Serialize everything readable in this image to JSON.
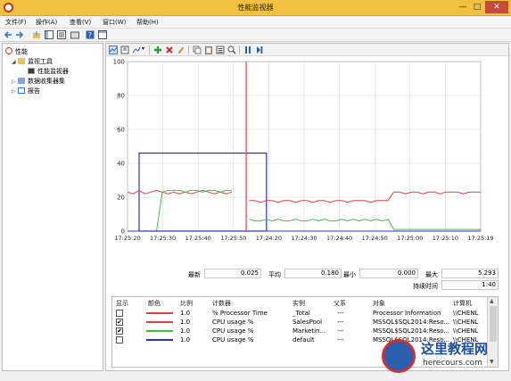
{
  "window": {
    "title": "性能监视器",
    "minimize": "—",
    "maximize": "□",
    "close": "✕"
  },
  "menu": [
    "文件(F)",
    "操作(A)",
    "查看(V)",
    "窗口(W)",
    "帮助(H)"
  ],
  "tree": [
    {
      "label": "性能",
      "icon": "performance-icon"
    },
    {
      "label": "监视工具",
      "icon": "folder-icon"
    },
    {
      "label": "性能监视器",
      "icon": "monitor-icon"
    },
    {
      "label": "数据收集器集",
      "icon": "data-collector-icon"
    },
    {
      "label": "报告",
      "icon": "report-icon"
    }
  ],
  "stats": {
    "last_label": "最新",
    "last_value": "0.025",
    "avg_label": "平均",
    "avg_value": "0.180",
    "min_label": "最小",
    "min_value": "0.000",
    "max_label": "最大",
    "max_value": "5.293",
    "duration_label": "持续时间",
    "duration_value": "1:40"
  },
  "table": {
    "headers": [
      "显示",
      "颜色",
      "比例",
      "计数器",
      "实例",
      "父系",
      "对象",
      "计算机"
    ],
    "rows": [
      {
        "checked": false,
        "color": "#e04040",
        "scale": "1.0",
        "counter": "% Processor Time",
        "instance": "_Total",
        "parent": "---",
        "object": "Processor Information",
        "computer": "\\\\CHENL"
      },
      {
        "checked": true,
        "color": "#e04040",
        "scale": "1.0",
        "counter": "CPU usage %",
        "instance": "SalesPool",
        "parent": "---",
        "object": "MSSQL$SQL2014:Reso...",
        "computer": "\\\\CHENL"
      },
      {
        "checked": true,
        "color": "#40c040",
        "scale": "1.0",
        "counter": "CPU usage %",
        "instance": "Marketin...",
        "parent": "---",
        "object": "MSSQL$SQL2014:Reso...",
        "computer": "\\\\CHENL"
      },
      {
        "checked": false,
        "color": "#3030c0",
        "scale": "1.0",
        "counter": "CPU usage %",
        "instance": "default",
        "parent": "---",
        "object": "MSSQL$SQL2014:Reso...",
        "computer": "\\\\CHENL"
      }
    ]
  },
  "watermark": {
    "title": "这里教程网",
    "url": "herecours.com"
  },
  "chart_data": {
    "type": "line",
    "ylim": [
      0,
      100
    ],
    "yticks": [
      0,
      20,
      40,
      60,
      80,
      100
    ],
    "xticks": [
      "17:25:20",
      "17:25:30",
      "17:25:40",
      "17:25:50",
      "17:24:20",
      "17:24:30",
      "17:24:40",
      "17:24:50",
      "17:25:00",
      "17:25:10",
      "17:25:19"
    ],
    "grid": true,
    "series": [
      {
        "color": "#e04040",
        "values": [
          23,
          22,
          24,
          22,
          23,
          24,
          23,
          22,
          23,
          22,
          23,
          22,
          23,
          24,
          23,
          22,
          23,
          22,
          23,
          null,
          null,
          18,
          18,
          17,
          18,
          18,
          17,
          18,
          18,
          17,
          18,
          18,
          17,
          18,
          18,
          17,
          18,
          18,
          17,
          18,
          18,
          18,
          17,
          18,
          18,
          18,
          23,
          23,
          22,
          23,
          23,
          22,
          23,
          23,
          22,
          23,
          23,
          23,
          22,
          23,
          23,
          23
        ]
      },
      {
        "color": "#40c040",
        "values": [
          0,
          0,
          0,
          0,
          0,
          0,
          23,
          24,
          24,
          24,
          23,
          24,
          24,
          23,
          24,
          24,
          23,
          24,
          24,
          null,
          null,
          7,
          6,
          6,
          7,
          6,
          7,
          6,
          6,
          7,
          6,
          6,
          7,
          6,
          7,
          6,
          6,
          7,
          6,
          7,
          6,
          7,
          6,
          7,
          6,
          7,
          1,
          1,
          1,
          1,
          1,
          1,
          1,
          1,
          1,
          1,
          1,
          1,
          1,
          1,
          1,
          1
        ]
      },
      {
        "color": "#3030c0",
        "values": [
          0,
          0,
          0,
          0,
          0,
          0,
          0,
          0,
          0,
          0,
          0,
          0,
          0,
          0,
          0,
          0,
          0,
          0,
          0,
          null,
          null,
          0,
          0,
          0,
          0,
          0,
          0,
          0,
          0,
          0,
          0,
          0,
          0,
          0,
          0,
          0,
          0,
          0,
          0,
          0,
          0,
          0,
          0,
          0,
          0,
          0,
          0,
          0,
          0,
          0,
          0,
          0,
          0,
          0,
          0,
          0,
          0,
          0,
          0,
          0,
          0,
          0
        ]
      }
    ],
    "cursor_index": 20,
    "selection": {
      "x_start_index": 2,
      "x_end_index": 24,
      "y_top": 46,
      "y_bottom": 0,
      "color": "#3030c0"
    }
  }
}
